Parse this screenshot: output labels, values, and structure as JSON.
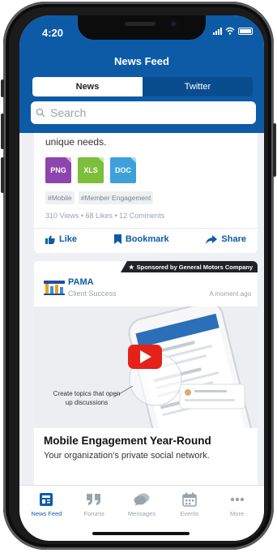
{
  "status_bar": {
    "time": "4:20"
  },
  "header": {
    "title": "News Feed",
    "tabs": [
      {
        "label": "News",
        "active": true
      },
      {
        "label": "Twitter",
        "active": false
      }
    ],
    "search_placeholder": "Search"
  },
  "colors": {
    "brand": "#0d5ba6",
    "png": "#8e44ad",
    "xls": "#7cbf3a",
    "doc": "#3ea0db"
  },
  "post1": {
    "text_fragment": "unique needs.",
    "files": [
      "PNG",
      "XLS",
      "DOC"
    ],
    "tags": [
      "#Mobile",
      "#Member Engagement"
    ],
    "stats": "310 Views  •  68 Likes  •  12 Comments",
    "actions": {
      "like": "Like",
      "bookmark": "Bookmark",
      "share": "Share"
    }
  },
  "post2": {
    "sponsor": "Sponsored by General Motors Company",
    "org_name": "PAMA",
    "org_sub": "Client Success",
    "posted": "A moment ago",
    "image_caption": "Create topics that open up discussions",
    "title": "Mobile Engagement Year-Round",
    "description": "Your organization's private social network."
  },
  "tabbar": [
    {
      "label": "News Feed",
      "icon": "news-feed-icon",
      "active": true
    },
    {
      "label": "Forums",
      "icon": "forums-icon",
      "active": false
    },
    {
      "label": "Messages",
      "icon": "messages-icon",
      "active": false
    },
    {
      "label": "Events",
      "icon": "events-icon",
      "active": false
    },
    {
      "label": "More",
      "icon": "more-icon",
      "active": false
    }
  ]
}
